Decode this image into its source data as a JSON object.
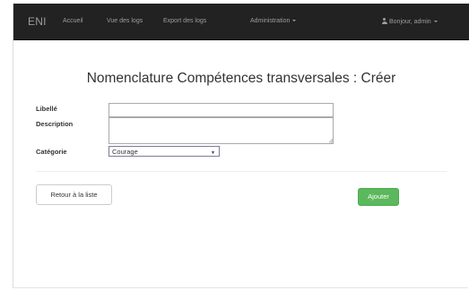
{
  "navbar": {
    "brand": "ENI",
    "links": [
      "Accueil",
      "Vue des logs",
      "Export des logs",
      "Administration"
    ],
    "user_label": "Bonjour, admin"
  },
  "page": {
    "title": "Nomenclature Compétences transversales : Créer"
  },
  "form": {
    "libelle_label": "Libellé",
    "libelle_value": "",
    "description_label": "Description",
    "description_value": "",
    "categorie_label": "Catégorie",
    "categorie_value": "Courage"
  },
  "actions": {
    "back_label": "Retour à la liste",
    "submit_label": "Ajouter"
  },
  "colors": {
    "navbar_bg": "#222222",
    "navbar_text": "#9d9d9d",
    "success": "#5cb85c"
  }
}
